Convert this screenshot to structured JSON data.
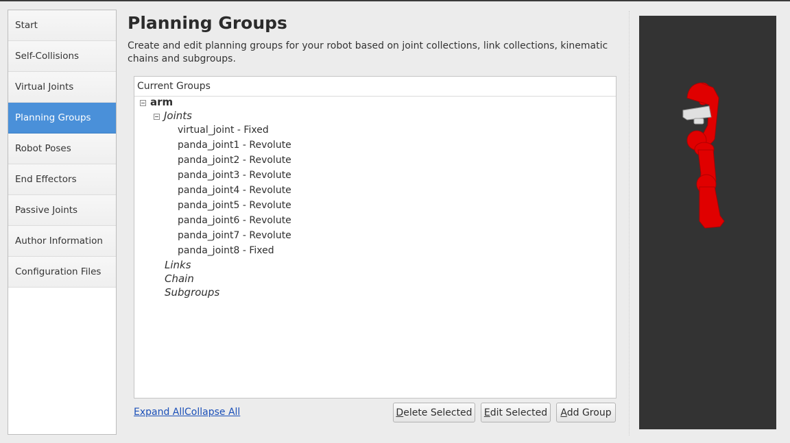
{
  "sidebar": {
    "items": [
      {
        "label": "Start",
        "active": false
      },
      {
        "label": "Self-Collisions",
        "active": false
      },
      {
        "label": "Virtual Joints",
        "active": false
      },
      {
        "label": "Planning Groups",
        "active": true
      },
      {
        "label": "Robot Poses",
        "active": false
      },
      {
        "label": "End Effectors",
        "active": false
      },
      {
        "label": "Passive Joints",
        "active": false
      },
      {
        "label": "Author Information",
        "active": false
      },
      {
        "label": "Configuration Files",
        "active": false
      }
    ]
  },
  "main": {
    "title": "Planning Groups",
    "description": "Create and edit planning groups for your robot based on joint collections, link collections, kinematic chains and subgroups."
  },
  "tree": {
    "header": "Current Groups",
    "group": "arm",
    "joints_label": "Joints",
    "joints": [
      "virtual_joint - Fixed",
      "panda_joint1 - Revolute",
      "panda_joint2 - Revolute",
      "panda_joint3 - Revolute",
      "panda_joint4 - Revolute",
      "panda_joint5 - Revolute",
      "panda_joint6 - Revolute",
      "panda_joint7 - Revolute",
      "panda_joint8 - Fixed"
    ],
    "links_label": "Links",
    "chain_label": "Chain",
    "subgroups_label": "Subgroups"
  },
  "actions": {
    "expand_all": "Expand All",
    "collapse_all": "Collapse All",
    "delete_first": "D",
    "delete_rest": "elete Selected",
    "edit_first": "E",
    "edit_rest": "dit Selected",
    "add_first": "A",
    "add_rest": "dd Group"
  },
  "colors": {
    "active_nav": "#4a90d9",
    "viewport_bg": "#333333",
    "robot": "#e00000",
    "link": "#1a4fb8"
  }
}
